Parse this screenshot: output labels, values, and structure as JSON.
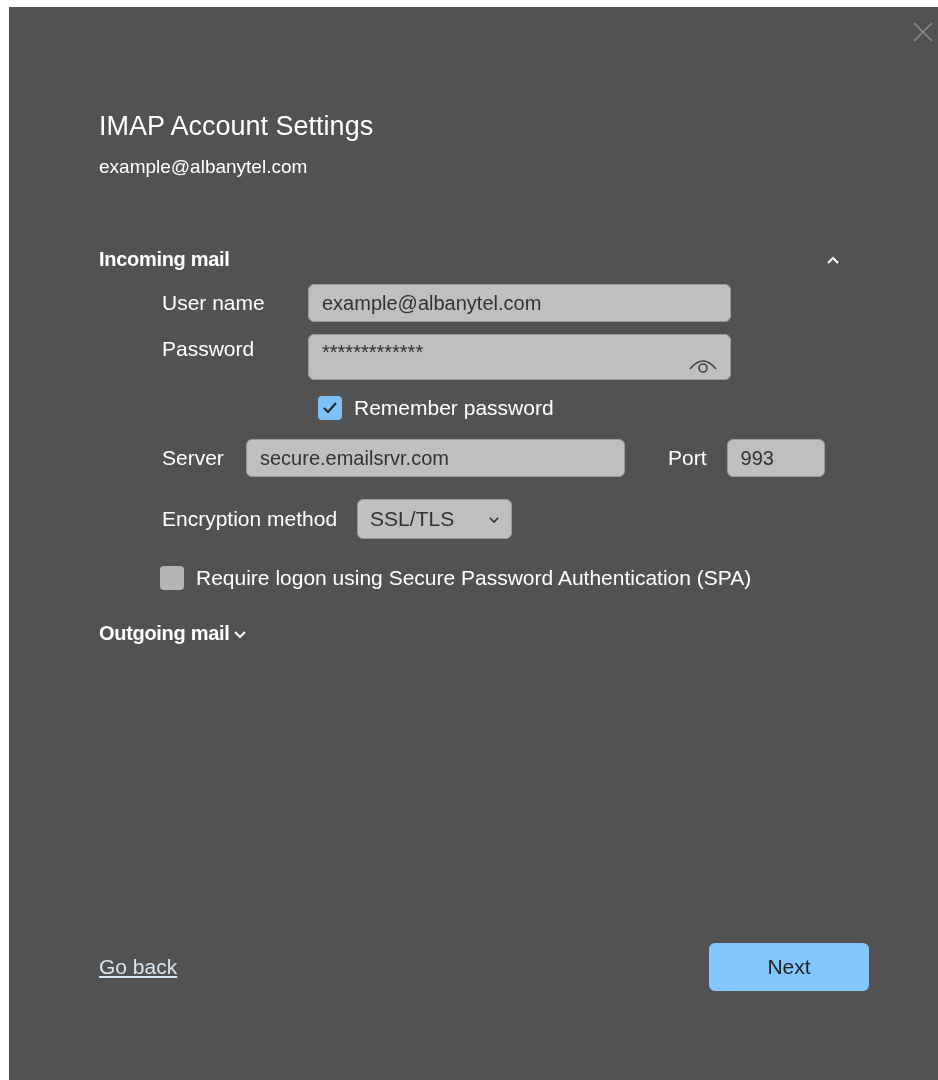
{
  "title": "IMAP Account Settings",
  "account": "example@albanytel.com",
  "incoming": {
    "label": "Incoming mail",
    "expanded": true,
    "user_name": {
      "label": "User name",
      "value": "example@albanytel.com"
    },
    "password": {
      "label": "Password",
      "value": "*************"
    },
    "remember_password": {
      "label": "Remember password",
      "checked": true
    },
    "server": {
      "label": "Server",
      "value": "secure.emailsrvr.com"
    },
    "port": {
      "label": "Port",
      "value": "993"
    },
    "encryption": {
      "label": "Encryption method",
      "value": "SSL/TLS"
    },
    "spa": {
      "label": "Require logon using Secure Password Authentication (SPA)",
      "checked": false
    }
  },
  "outgoing": {
    "label": "Outgoing mail",
    "expanded": false
  },
  "go_back": "Go back",
  "next": "Next"
}
